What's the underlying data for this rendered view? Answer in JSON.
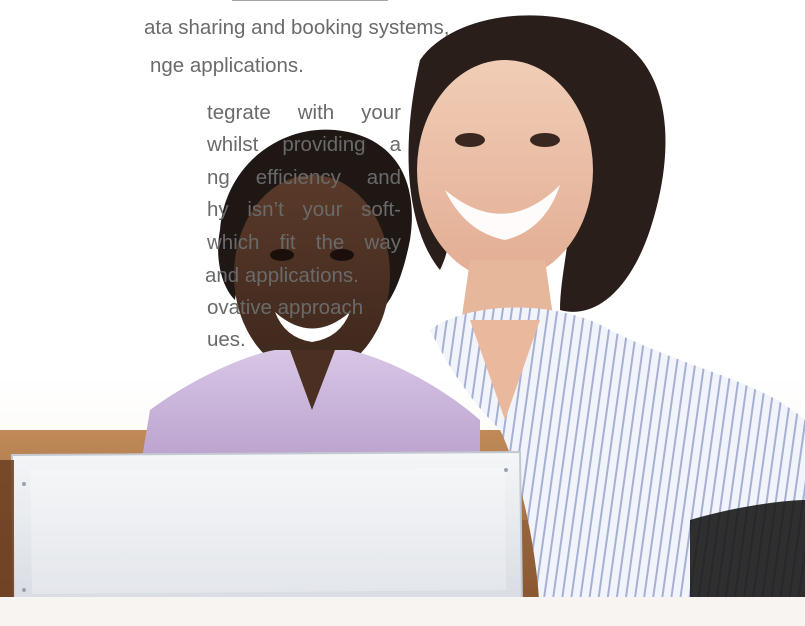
{
  "paragraph_intro_tail": {
    "line1": "ata sharing and booking systems,",
    "line2": "nge applications."
  },
  "paragraph_main": {
    "line1": "tegrate with your",
    "line2": "whilst providing a",
    "line3": "ng efficiency and",
    "line4": "hy isn’t your soft-",
    "line5": "which fit the way",
    "line6": "and applications.",
    "line7": "ovative approach",
    "line8": "ues."
  },
  "colors": {
    "text": "#6a6a6a",
    "shirt_left": "#c9b4d8",
    "shirt_right_stripes": "#9aa6c8",
    "monitor": "#e4e7ec"
  }
}
